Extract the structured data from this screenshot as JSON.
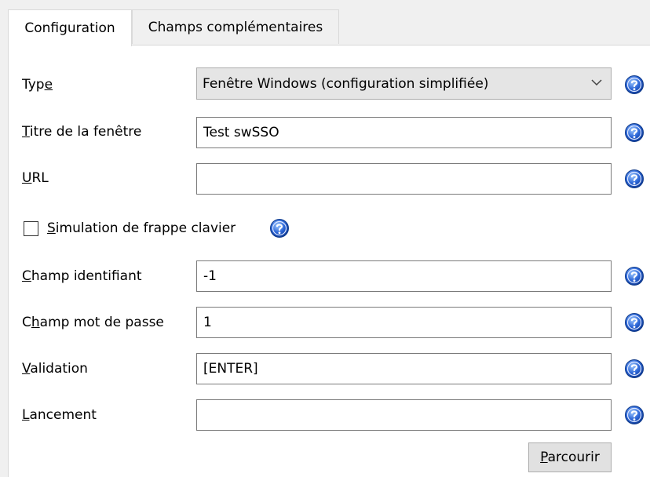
{
  "tabs": [
    {
      "label": "Configuration",
      "active": true
    },
    {
      "label": "Champs complémentaires",
      "active": false
    }
  ],
  "form": {
    "type": {
      "label_pre": "Typ",
      "label_u": "e",
      "label_post": "",
      "value": "Fenêtre Windows (configuration simplifiée)"
    },
    "titre": {
      "label_pre": "",
      "label_u": "T",
      "label_post": "itre de la fenêtre",
      "value": "Test swSSO"
    },
    "url": {
      "label_pre": "",
      "label_u": "U",
      "label_post": "RL",
      "value": ""
    },
    "simulation": {
      "label_pre": "",
      "label_u": "S",
      "label_post": "imulation de frappe clavier",
      "checked": false
    },
    "champ_identifiant": {
      "label_pre": "",
      "label_u": "C",
      "label_post": "hamp identifiant",
      "value": "-1"
    },
    "champ_mot_de_passe": {
      "label_pre": "C",
      "label_u": "h",
      "label_post": "amp mot de passe",
      "value": "1"
    },
    "validation": {
      "label_pre": "",
      "label_u": "V",
      "label_post": "alidation",
      "value": "[ENTER]"
    },
    "lancement": {
      "label_pre": "",
      "label_u": "L",
      "label_post": "ancement",
      "value": ""
    },
    "parcourir": {
      "label_pre": "",
      "label_u": "P",
      "label_post": "arcourir"
    }
  },
  "icons": {
    "help": "help-icon",
    "dropdown": "chevron-down-icon",
    "help_color": "#1f4fbf"
  }
}
